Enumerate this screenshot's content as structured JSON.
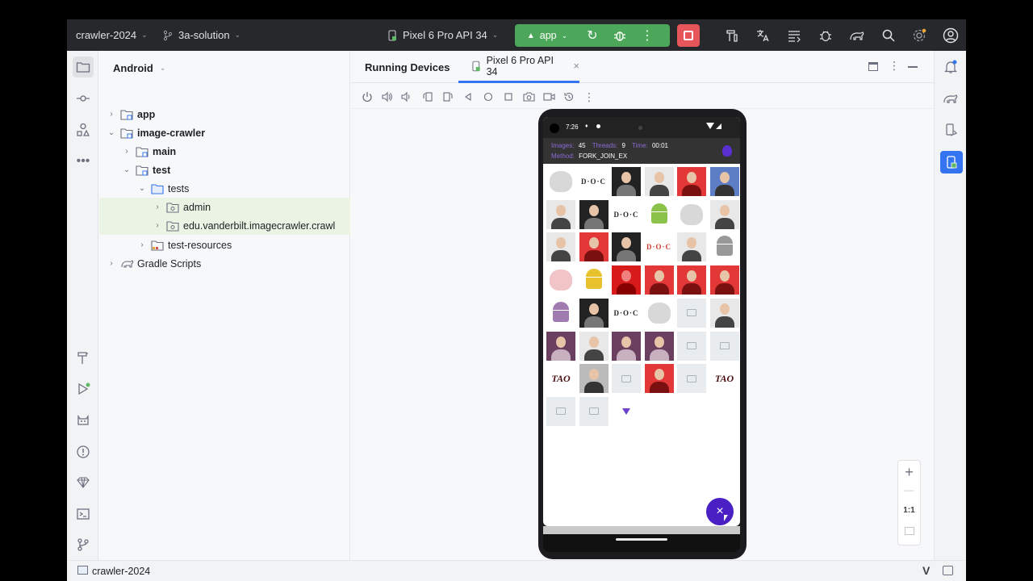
{
  "titlebar": {
    "project": "crawler-2024",
    "branch": "3a-solution",
    "device": "Pixel 6 Pro API 34",
    "run_config": "app"
  },
  "project_panel": {
    "title": "Android",
    "tree": [
      {
        "label": "app",
        "bold": true,
        "level": 0,
        "arrow": "›",
        "icon": "module-folder-icon"
      },
      {
        "label": "image-crawler",
        "bold": true,
        "level": 0,
        "arrow": "⌄",
        "icon": "module-folder-icon"
      },
      {
        "label": "main",
        "bold": true,
        "level": 1,
        "arrow": "›",
        "icon": "module-folder-icon"
      },
      {
        "label": "test",
        "bold": true,
        "level": 1,
        "arrow": "⌄",
        "icon": "module-folder-icon"
      },
      {
        "label": "tests",
        "bold": false,
        "level": 2,
        "arrow": "⌄",
        "icon": "folder-icon"
      },
      {
        "label": "admin",
        "bold": false,
        "level": 3,
        "arrow": "›",
        "icon": "package-icon"
      },
      {
        "label": "edu.vanderbilt.imagecrawler.crawl",
        "bold": false,
        "level": 3,
        "arrow": "›",
        "icon": "package-icon"
      },
      {
        "label": "test-resources",
        "bold": false,
        "level": 2,
        "arrow": "›",
        "icon": "resources-folder-icon"
      },
      {
        "label": "Gradle Scripts",
        "bold": false,
        "level": 0,
        "arrow": "›",
        "icon": "gradle-icon"
      }
    ]
  },
  "main": {
    "tab_running": "Running Devices",
    "tab_device": "Pixel 6 Pro API 34"
  },
  "phone": {
    "time": "7:26",
    "stats": {
      "images_label": "Images:",
      "images_value": "45",
      "threads_label": "Threads:",
      "threads_value": "9",
      "time_label": "Time:",
      "time_value": "00:01",
      "method_label": "Method:",
      "method_value": "FORK_JOIN_EX"
    },
    "fab_label": "×"
  },
  "zoom": {
    "plus": "+",
    "minus": "—",
    "one_to_one": "1:1"
  },
  "status": {
    "project": "crawler-2024"
  },
  "colors": {
    "run_green": "#4ca75a",
    "stop_red": "#e5555a",
    "accent_blue": "#3574f0",
    "fab_purple": "#4a1fc4"
  }
}
